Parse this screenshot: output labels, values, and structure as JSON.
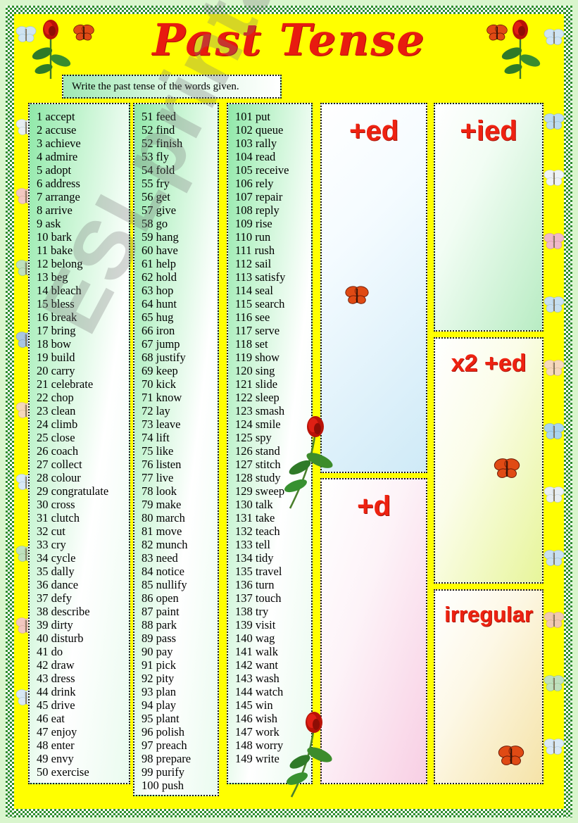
{
  "title": "Past Tense",
  "instruction": "Write the past tense of the words given.",
  "watermark": "ESLprintables.com",
  "colors": {
    "page_background": "#ffff00",
    "title_red": "#e81b10",
    "tag_red": "#ee2211",
    "frame_green": "#2f8f2f",
    "word_text": "#000000"
  },
  "word_columns": [
    {
      "name": "column-1",
      "words": [
        "1 accept",
        "2 accuse",
        "3 achieve",
        "4 admire",
        "5 adopt",
        "6 address",
        "7 arrange",
        "8 arrive",
        "9 ask",
        "10 bark",
        "11 bake",
        "12 belong",
        "13 beg",
        "14 bleach",
        "15 bless",
        "16 break",
        "17 bring",
        "18 bow",
        "19 build",
        "20 carry",
        "21 celebrate",
        "22 chop",
        "23 clean",
        "24 climb",
        "25 close",
        "26 coach",
        "27 collect",
        "28 colour",
        "29 congratulate",
        "30 cross",
        "31 clutch",
        "32 cut",
        "33 cry",
        "34 cycle",
        "35 dally",
        "36 dance",
        "37 defy",
        "38 describe",
        "39 dirty",
        "40 disturb",
        "41 do",
        "42 draw",
        "43 dress",
        "44 drink",
        "45 drive",
        "46 eat",
        "47 enjoy",
        "48 enter",
        "49 envy",
        "50 exercise"
      ]
    },
    {
      "name": "column-2",
      "words": [
        "51 feed",
        "52 find",
        "52 finish",
        "53 fly",
        "54 fold",
        "55 fry",
        "56 get",
        "57 give",
        "58 go",
        "59 hang",
        "60 have",
        "61 help",
        "62 hold",
        "63 hop",
        "64 hunt",
        "65 hug",
        "66 iron",
        "67 jump",
        "68 justify",
        "69 keep",
        "70 kick",
        "71 know",
        "72 lay",
        "73 leave",
        "74 lift",
        "75 like",
        "76 listen",
        "77 live",
        "78 look",
        "79 make",
        "80 march",
        "81 move",
        "82 munch",
        "83 need",
        "84 notice",
        "85 nullify",
        "86 open",
        "87 paint",
        "88 park",
        "89 pass",
        "90 pay",
        "91 pick",
        "92 pity",
        "93 plan",
        "94 play",
        "95 plant",
        "96 polish",
        "97 preach",
        "98 prepare",
        "99 purify",
        "100 push"
      ]
    },
    {
      "name": "column-3",
      "words": [
        "101 put",
        "102 queue",
        "103 rally",
        "104 read",
        "105 receive",
        "106 rely",
        "107 repair",
        "108 reply",
        "109 rise",
        "110 run",
        "111 rush",
        "112 sail",
        "113 satisfy",
        "114 seal",
        "115 search",
        "116 see",
        "117 serve",
        "118 set",
        "119 show",
        "120 sing",
        "121 slide",
        "122 sleep",
        "123 smash",
        "124 smile",
        "125 spy",
        "126 stand",
        "127 stitch",
        "128 study",
        "129 sweep",
        "130 talk",
        "131 take",
        "132 teach",
        "133 tell",
        "134 tidy",
        "135 travel",
        "136 turn",
        "137 touch",
        "138 try",
        "139 visit",
        "140 wag",
        "141 walk",
        "142 want",
        "143 wash",
        "144 watch",
        "145 win",
        "146 wish",
        "147 work",
        "148 worry",
        "149 write"
      ]
    }
  ],
  "answer_boxes": [
    {
      "name": "answer-box-ed",
      "label": "+ed"
    },
    {
      "name": "answer-box-ied",
      "label": "+ied"
    },
    {
      "name": "answer-box-x2-ed",
      "label": "x2 +ed"
    },
    {
      "name": "answer-box-d",
      "label": "+d"
    },
    {
      "name": "answer-box-irregular",
      "label": "irregular"
    }
  ]
}
